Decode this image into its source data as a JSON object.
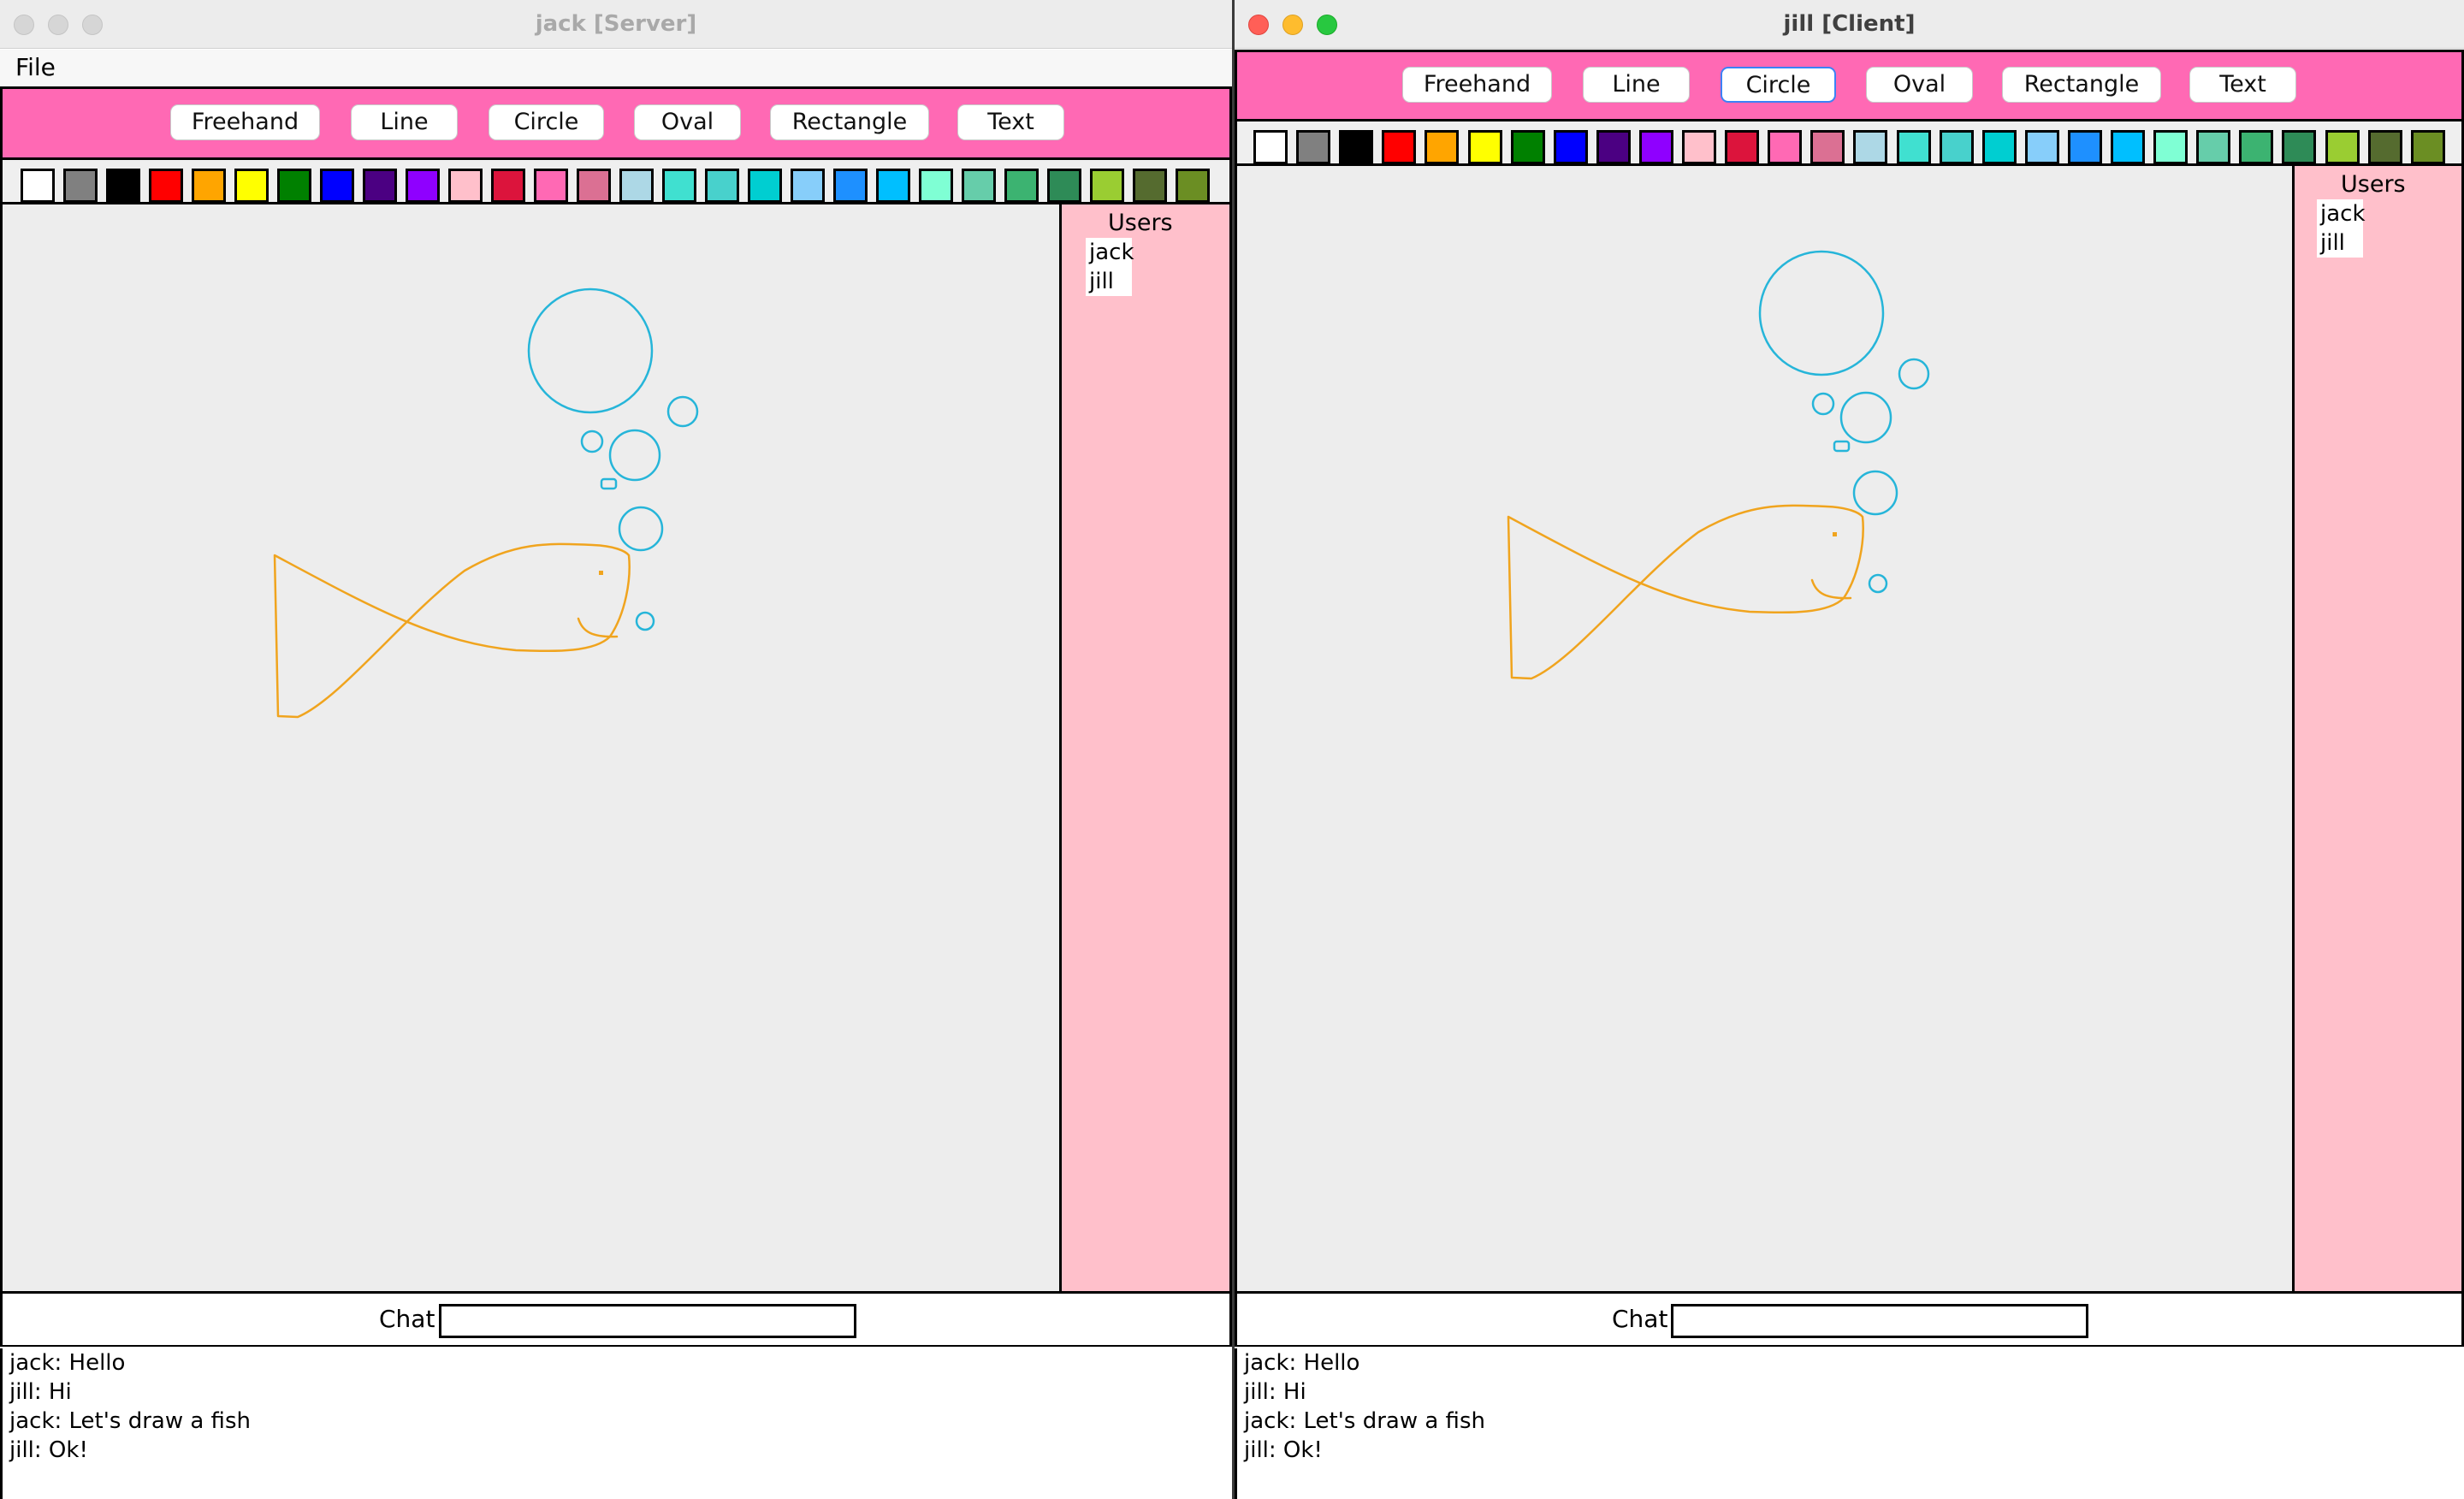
{
  "windows": [
    {
      "title": "jack [Server]",
      "menu": [
        "File"
      ],
      "tools": [
        "Freehand",
        "Line",
        "Circle",
        "Oval",
        "Rectangle",
        "Text"
      ],
      "users_label": "Users",
      "users": [
        "jack",
        "jill"
      ],
      "chat_label": "Chat",
      "chat_input_value": "",
      "messages": [
        "jack: Hello",
        "jill: Hi",
        "jack: Let's draw a fish",
        "jill: Ok!"
      ]
    },
    {
      "title": "jill [Client]",
      "menu": [],
      "tools": [
        "Freehand",
        "Line",
        "Circle",
        "Oval",
        "Rectangle",
        "Text"
      ],
      "selected_tool": "Circle",
      "users_label": "Users",
      "users": [
        "jack",
        "jill"
      ],
      "chat_label": "Chat",
      "chat_input_value": "",
      "messages": [
        "jack: Hello",
        "jill: Hi",
        "jack: Let's draw a fish",
        "jill: Ok!"
      ]
    }
  ],
  "palette": [
    "#ffffff",
    "#808080",
    "#000000",
    "#ff0000",
    "#ffa500",
    "#ffff00",
    "#008000",
    "#0000ff",
    "#4b0082",
    "#8f00ff",
    "#ffc0cb",
    "#dc143c",
    "#ff69b4",
    "#db7093",
    "#add8e6",
    "#40e0d0",
    "#48d1cc",
    "#00ced1",
    "#87cefa",
    "#1e90ff",
    "#00bfff",
    "#7fffd4",
    "#66cdaa",
    "#3cb371",
    "#2e8b57",
    "#9acd32",
    "#556b2f",
    "#6b8e23"
  ],
  "colors": {
    "toolbar": "#ff69b4",
    "users_panel": "#ffc0cb",
    "canvas": "#ededed",
    "bubble_stroke": "#26b5d9",
    "fish_stroke": "#f0a41e"
  },
  "icons": {
    "close": "traffic-close-icon",
    "minimize": "traffic-minimize-icon",
    "maximize": "traffic-maximize-icon"
  }
}
